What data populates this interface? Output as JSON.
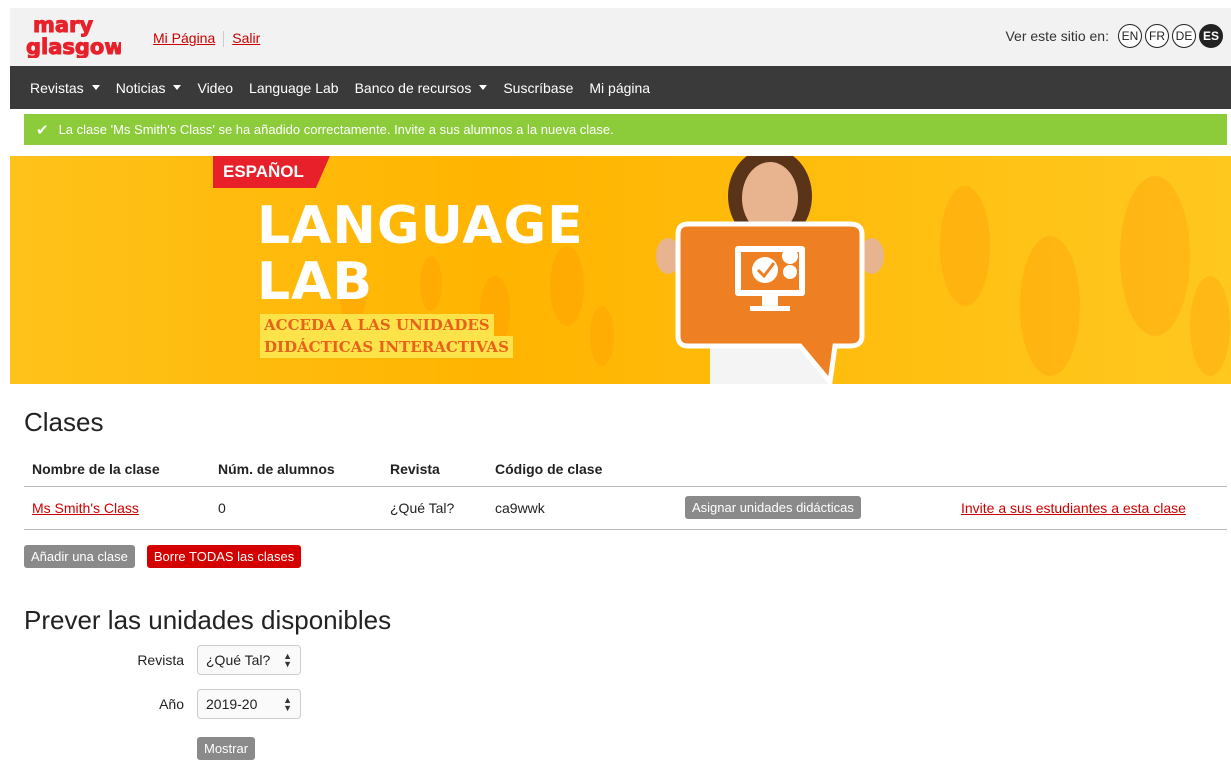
{
  "topbar": {
    "logo_text": "mary glasgow",
    "links": [
      "Mi Página",
      "Salir"
    ],
    "lang_label": "Ver este sitio en:",
    "languages": [
      "EN",
      "FR",
      "DE",
      "ES"
    ],
    "active_language": "ES"
  },
  "nav": {
    "items": [
      "Revistas",
      "Noticias",
      "Video",
      "Language Lab",
      "Banco de recursos",
      "Suscríbase",
      "Mi página"
    ]
  },
  "alert": {
    "message": "La clase 'Ms Smith's Class' se ha añadido correctamente. Invite a sus alumnos a la nueva clase."
  },
  "banner": {
    "tag": "ESPAÑOL",
    "title_line1": "LANGUAGE",
    "title_line2": "LAB",
    "subtitle_line1": "ACCEDA A LAS UNIDADES",
    "subtitle_line2": "DIDÁCTICAS INTERACTIVAS"
  },
  "clases": {
    "heading": "Clases",
    "columns": [
      "Nombre de la clase",
      "Núm. de alumnos",
      "Revista",
      "Código de clase"
    ],
    "rows": [
      {
        "name": "Ms Smith's Class",
        "students": "0",
        "magazine": "¿Qué Tal?",
        "code": "ca9wwk",
        "assign_label": "Asignar unidades didácticas",
        "invite_label": "Invite a sus estudiantes a esta clase"
      }
    ],
    "add_label": "Añadir una clase",
    "delete_all_label": "Borre TODAS las clases"
  },
  "prever": {
    "heading": "Prever las unidades disponibles",
    "revista_label": "Revista",
    "revista_value": "¿Qué Tal?",
    "anio_label": "Año",
    "anio_value": "2019-20",
    "show_label": "Mostrar"
  },
  "colors": {
    "brand_red": "#cc0000",
    "success_green": "#8ccb3a",
    "nav_bg": "#3a3a3a",
    "banner_yellow": "#ffc21a"
  }
}
